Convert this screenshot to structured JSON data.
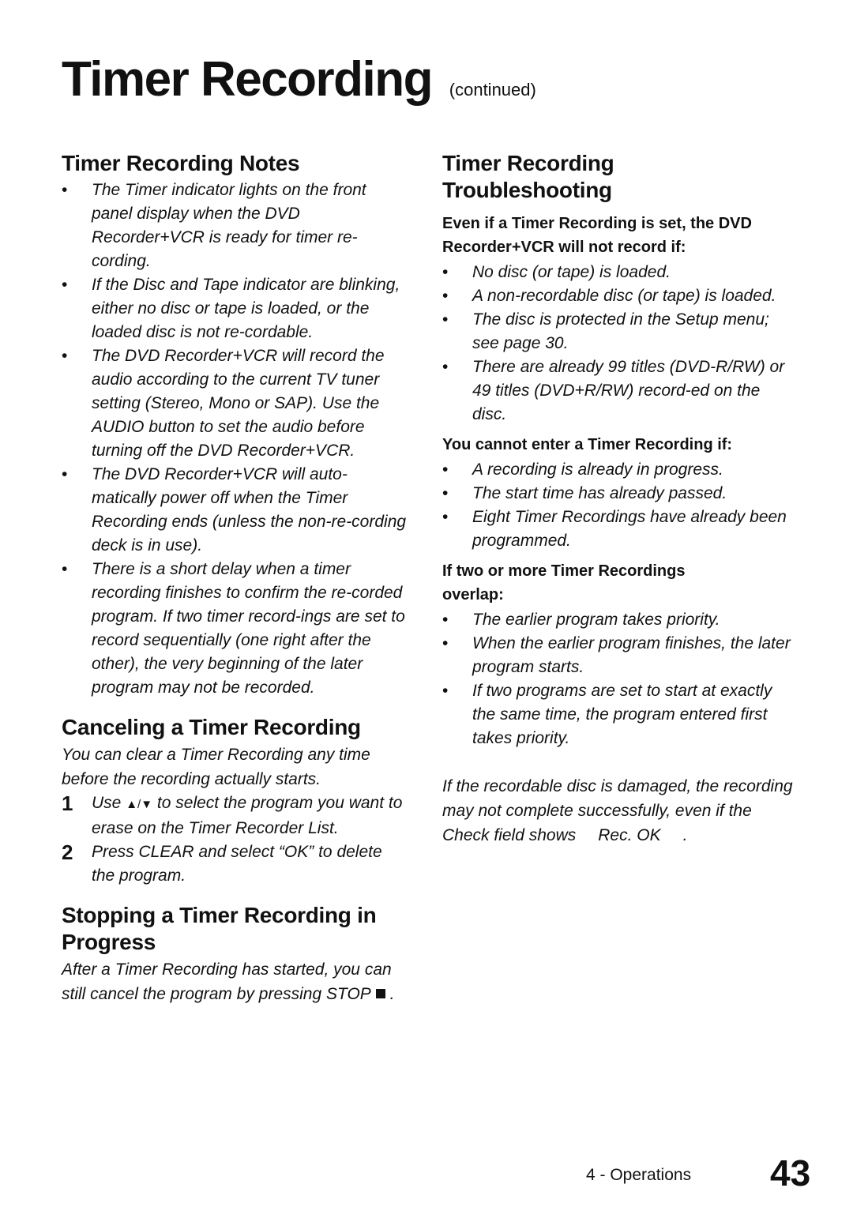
{
  "page_title": "Timer Recording",
  "page_title_suffix": "(continued)",
  "left": {
    "notes": {
      "heading": "Timer Recording Notes",
      "items": [
        "The Timer indicator lights on the front panel display when the DVD Recorder+VCR is ready for timer re-cording.",
        "If the Disc and Tape indicator are blinking, either no disc or tape is loaded, or the loaded disc is not re-cordable.",
        "The DVD Recorder+VCR will record the audio according to the current TV tuner setting (Stereo, Mono or SAP). Use the AUDIO button to set the audio before turning off the DVD Recorder+VCR.",
        "The DVD Recorder+VCR will auto-matically power off when the Timer Recording ends (unless the non-re-cording deck is in use).",
        "There is a short delay when a timer recording finishes to confirm the re-corded program. If two timer record-ings are set to record sequentially (one right after the other), the very beginning of the later program may not be recorded."
      ]
    },
    "canceling": {
      "heading": "Canceling a Timer Recording",
      "intro": "You can clear a Timer Recording any time before the recording actually starts.",
      "steps": [
        {
          "num": "1",
          "pre": "Use",
          "arrows": "▲/▼",
          "post": "to select the program you want to erase on the Timer Recorder List."
        },
        {
          "num": "2",
          "text": "Press CLEAR and select “OK” to delete the program."
        }
      ]
    },
    "stopping": {
      "heading": "Stopping a Timer Recording in Progress",
      "text": "After a Timer Recording has started, you can still cancel the program by pressing STOP",
      "end": "."
    }
  },
  "right": {
    "troubleshooting": {
      "heading": "Timer Recording Troubleshooting",
      "groups": [
        {
          "title": "Even if a Timer Recording is set, the DVD Recorder+VCR will not record if:",
          "items": [
            "No disc (or tape) is loaded.",
            "A non-recordable disc (or tape) is loaded.",
            "The disc is protected in the Setup menu; see page 30.",
            "There are already 99 titles (DVD-R/RW) or 49 titles (DVD+R/RW) record-ed on the disc."
          ]
        },
        {
          "title": "You cannot enter a Timer Recording if:",
          "items": [
            "A recording is already in progress.",
            "The start time has already passed.",
            "Eight Timer Recordings have already been programmed."
          ]
        },
        {
          "title": "If two or more Timer Recordings overlap:",
          "items": [
            "The earlier program takes priority.",
            "When the earlier program finishes, the later program starts.",
            "If two programs are set to start at exactly the same time, the program entered first takes priority."
          ]
        }
      ],
      "note_pre": "If the recordable disc is damaged, the recording may not complete successfully, even if the Check field shows",
      "note_value": "Rec. OK",
      "note_end": "."
    }
  },
  "footer": {
    "section": "4 - Operations",
    "page_number": "43"
  }
}
